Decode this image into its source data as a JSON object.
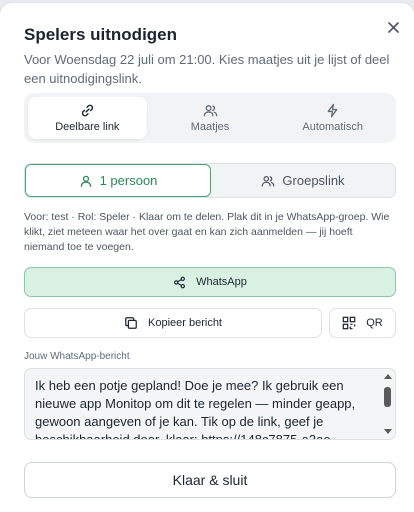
{
  "dialog": {
    "title": "Spelers uitnodigen",
    "close_icon": "close-icon",
    "subtitle": "Voor Woensdag 22 juli om 21:00. Kies maatjes uit je lijst of deel een uitnodigingslink."
  },
  "modes": [
    {
      "label": "Deelbare link",
      "icon": "link-icon",
      "active": true
    },
    {
      "label": "Maatjes",
      "icon": "users-icon",
      "active": false
    },
    {
      "label": "Automatisch",
      "icon": "lightning-icon",
      "active": false
    }
  ],
  "audience": {
    "single_label": "1 persoon",
    "group_label": "Groepslink",
    "selected": "single"
  },
  "info_text": "Voor: test · Rol: Speler · Klaar om te delen. Plak dit in je WhatsApp-groep. Wie klikt, ziet meteen waar het over gaat en kan zich aanmelden — jij hoeft niemand toe te voegen.",
  "actions": {
    "whatsapp_label": "WhatsApp",
    "copy_label": "Kopieer bericht",
    "qr_label": "QR"
  },
  "message": {
    "label": "Jouw WhatsApp-bericht",
    "text": "Ik heb een potje gepland! Doe je mee? Ik gebruik een nieuwe app Monitop om dit te regelen — minder geapp, gewoon aangeven of je kan. Tik op de link, geef je beschikbaarheid door, klaar: https://148c7875-a3ae"
  },
  "footer": {
    "done_label": "Klaar & sluit"
  },
  "colors": {
    "accent_green": "#2a8a58",
    "whatsapp_bg": "#d9f1e3"
  }
}
